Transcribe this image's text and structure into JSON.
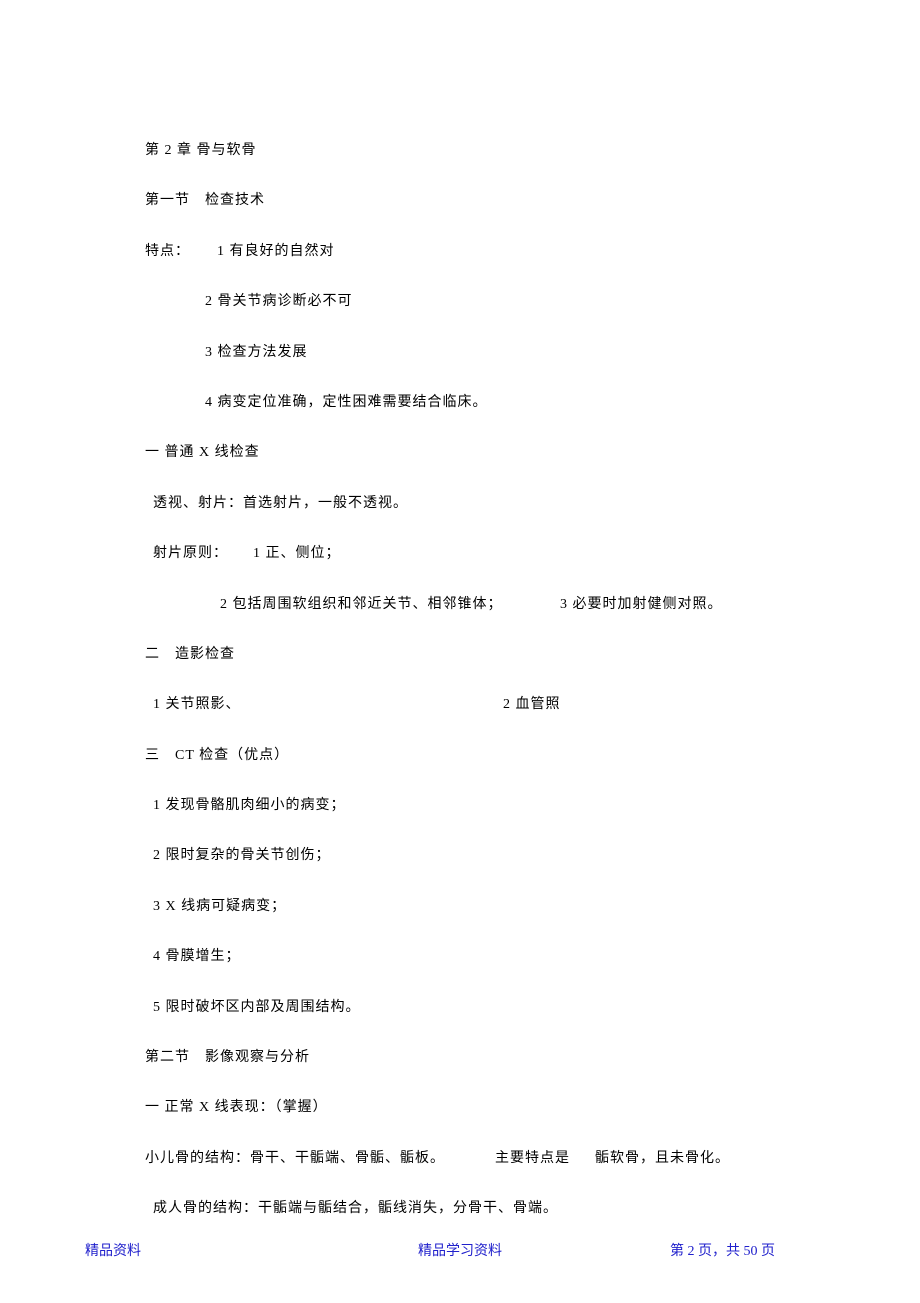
{
  "chapter": {
    "heading": "第 2 章   骨与软骨"
  },
  "section1": {
    "heading": "第一节　检查技术",
    "features_label": "特点：",
    "features": {
      "f1": "1  有良好的自然对",
      "f2": "2  骨关节病诊断必不可",
      "f3": "3  检查方法发展",
      "f4": "4  病变定位准确，定性困难需要结合临床。"
    },
    "sub1": {
      "heading": "一  普通 X  线检查",
      "line1": "透视、射片：首选射片，一般不透视。",
      "principles_label": "射片原则：",
      "p1": "1  正、侧位；",
      "p2": "2  包括周围软组织和邻近关节、相邻锥体；",
      "p3": "3  必要时加射健侧对照。"
    },
    "sub2": {
      "heading": "二　造影检查",
      "item1": "1  关节照影、",
      "item2": "2  血管照"
    },
    "sub3": {
      "heading": "三　CT 检查（优点）",
      "item1": "1 发现骨骼肌肉细小的病变；",
      "item2": "2 限时复杂的骨关节创伤；",
      "item3": "3 X 线病可疑病变；",
      "item4": "4 骨膜增生；",
      "item5": "5 限时破坏区内部及周围结构。"
    }
  },
  "section2": {
    "heading": "第二节　影像观察与分析",
    "sub1": {
      "heading": "一  正常 X  线表现：（掌握）",
      "line1_a": "小儿骨的结构：骨干、干骺端、骨骺、骺板。",
      "line1_b": "主要特点是",
      "line1_c": "骺软骨，且未骨化。",
      "line2": "成人骨的结构：干骺端与骺结合，骺线消失，分骨干、骨端。"
    }
  },
  "footer": {
    "left": "精品资料",
    "center": "精品学习资料",
    "right_prefix": "第 ",
    "right_page": "2",
    "right_mid": " 页，共 ",
    "right_total": "50",
    "right_suffix": " 页"
  }
}
